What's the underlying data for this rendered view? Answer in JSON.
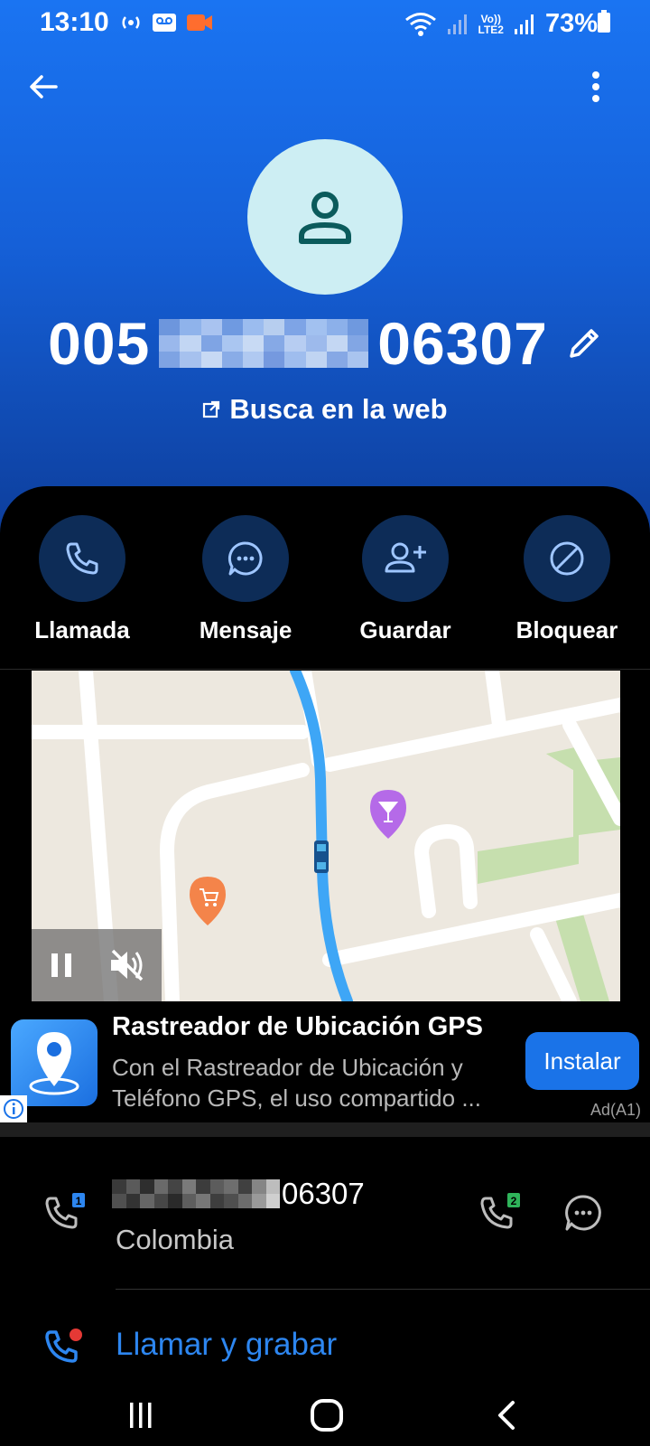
{
  "status_bar": {
    "time": "13:10",
    "battery": "73%",
    "sim2_label": "LTE2"
  },
  "contact": {
    "number_prefix": "005",
    "number_suffix": "06307",
    "web_search": "Busca en la web"
  },
  "actions": [
    {
      "label": "Llamada",
      "icon": "phone-icon"
    },
    {
      "label": "Mensaje",
      "icon": "message-icon"
    },
    {
      "label": "Guardar",
      "icon": "add-contact-icon"
    },
    {
      "label": "Bloquear",
      "icon": "block-icon"
    }
  ],
  "ad": {
    "title": "Rastreador de Ubicación GPS",
    "description": "Con el Rastreador de Ubicación y Teléfono GPS, el uso compartido ...",
    "install_label": "Instalar",
    "badge": "Ad(A1)"
  },
  "number_details": {
    "suffix": "06307",
    "country": "Colombia",
    "sim1_badge": "1",
    "sim2_badge": "2"
  },
  "record": {
    "label": "Llamar y grabar"
  },
  "colors": {
    "header_top": "#1a74f2",
    "header_bottom": "#0d3d9a",
    "accent": "#1a73e8",
    "action_circle": "#0d2c57",
    "link": "#2d86f0"
  }
}
